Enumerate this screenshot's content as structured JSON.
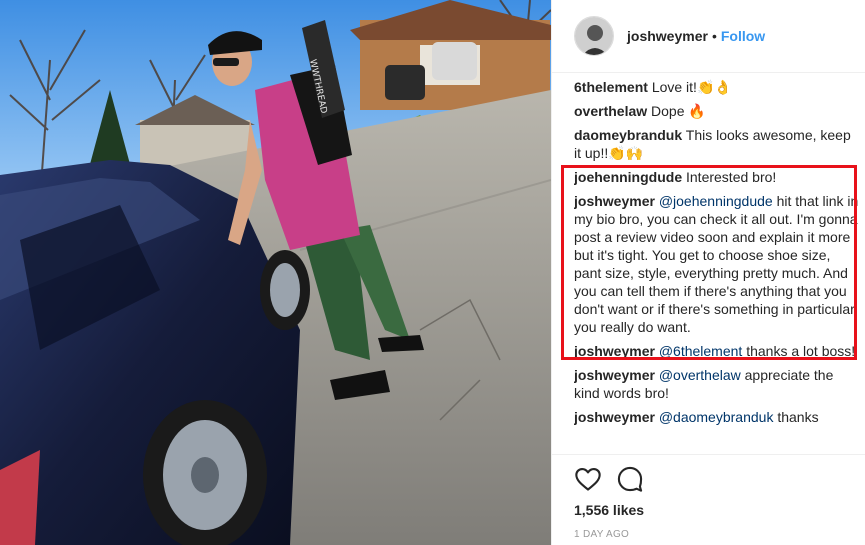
{
  "post": {
    "username": "joshweymer",
    "separator": "•",
    "follow_label": "Follow",
    "board_text": "WWTHREAD"
  },
  "comments": [
    {
      "user": "6thelement",
      "text": "Love it!👏👌"
    },
    {
      "user": "overthelaw",
      "text": "Dope 🔥"
    },
    {
      "user": "daomeybranduk",
      "text": "This looks awesome, keep it up!!👏🙌"
    },
    {
      "user": "joehenningdude",
      "text": "Interested bro!"
    },
    {
      "user": "joshweymer",
      "mention": "@joehenningdude",
      "text": "hit that link in my bio bro, you can check it all out. I'm gonna post a review video soon and explain it more but it's tight. You get to choose shoe size, pant size, style, everything pretty much. And you can tell them if there's anything that you don't want or if there's something in particular you really do want."
    },
    {
      "user": "joshweymer",
      "mention": "@6thelement",
      "text": "thanks a lot boss!"
    },
    {
      "user": "joshweymer",
      "mention": "@overthelaw",
      "text": "appreciate the kind words bro!"
    },
    {
      "user": "joshweymer",
      "mention": "@daomeybranduk",
      "text": "thanks"
    }
  ],
  "stats": {
    "likes": "1,556 likes",
    "timestamp": "1 DAY AGO"
  },
  "icons": {
    "like": "heart-outline-icon",
    "comment": "speech-bubble-icon"
  },
  "colors": {
    "follow": "#3897f0",
    "highlight": "#e8111a",
    "mention": "#003569"
  }
}
